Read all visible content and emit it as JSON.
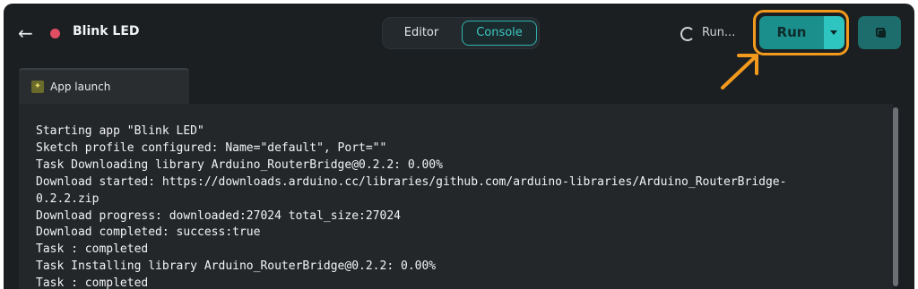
{
  "header": {
    "back_icon": "arrow-left-icon",
    "status_color": "#e04e64",
    "app_title": "Blink LED",
    "tabs": {
      "editor": "Editor",
      "console": "Console"
    },
    "running_label": "Run...",
    "run_label": "Run",
    "accent": "#2ec4c0",
    "highlight_color": "#f29a1d"
  },
  "tab_strip": {
    "active_tab": "App launch",
    "icon": "app-launch-icon"
  },
  "console": {
    "lines": [
      "Starting app \"Blink LED\"",
      "Sketch profile configured: Name=\"default\", Port=\"\"",
      "Task Downloading library Arduino_RouterBridge@0.2.2: 0.00%",
      "Download started: https://downloads.arduino.cc/libraries/github.com/arduino-libraries/Arduino_RouterBridge-",
      "0.2.2.zip",
      "Download progress: downloaded:27024 total_size:27024",
      "Download completed: success:true",
      "Task : completed",
      "Task Installing library Arduino_RouterBridge@0.2.2: 0.00%",
      "Task : completed"
    ]
  }
}
